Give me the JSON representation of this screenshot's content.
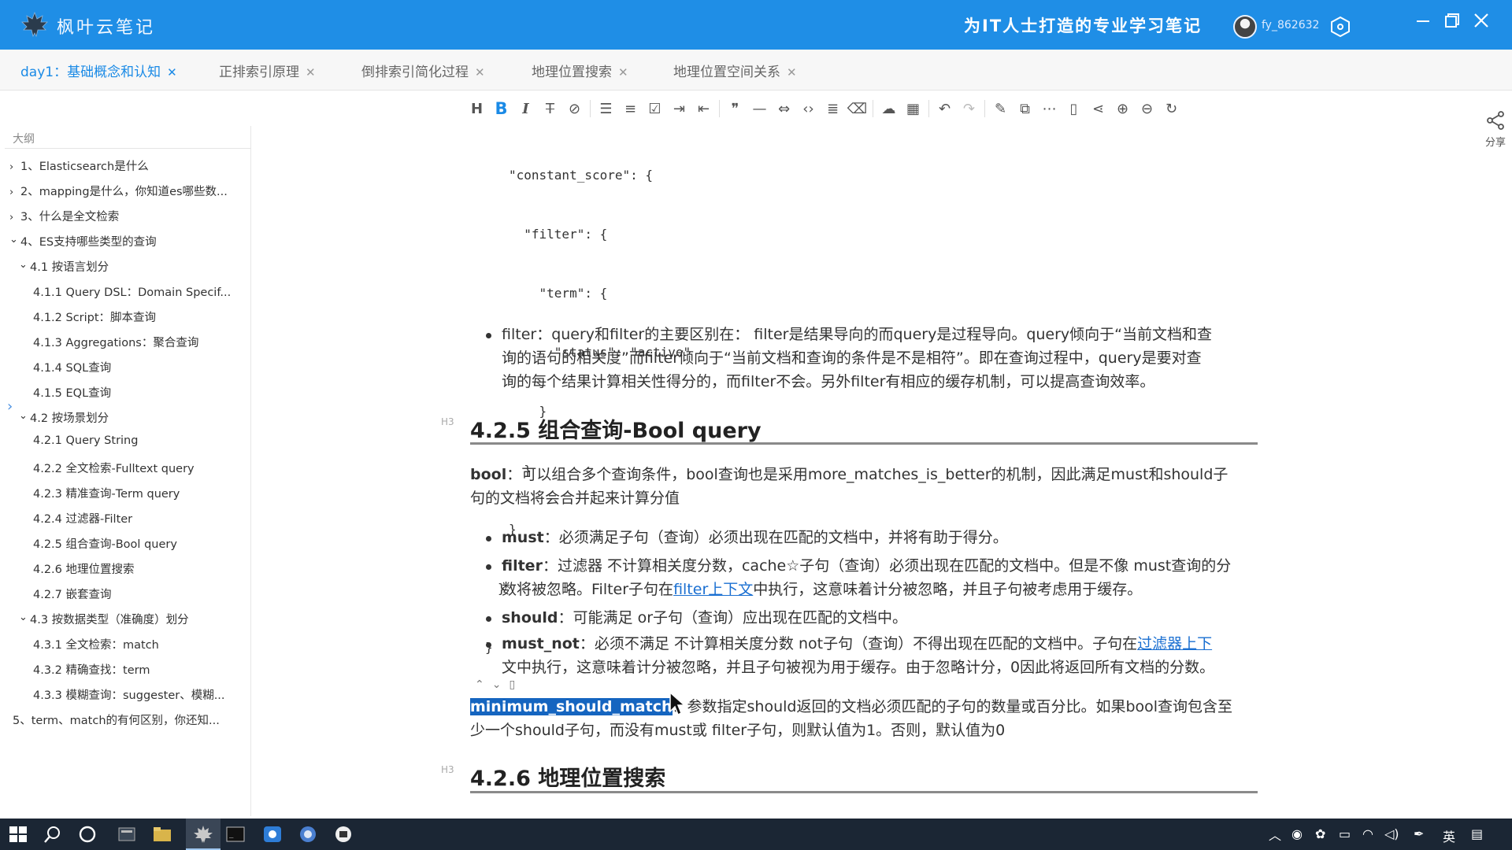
{
  "app": {
    "name": "枫叶云笔记",
    "slogan": "为IT人士打造的专业学习笔记",
    "username": "fy_862632"
  },
  "tabs": [
    {
      "label": "day1：基础概念和认知",
      "active": true
    },
    {
      "label": "正排索引原理",
      "active": false
    },
    {
      "label": "倒排索引简化过程",
      "active": false
    },
    {
      "label": "地理位置搜索",
      "active": false
    },
    {
      "label": "地理位置空间关系",
      "active": false
    }
  ],
  "toolbar": {
    "icons": [
      "heading-icon",
      "bold-icon",
      "italic-icon",
      "strikethrough-icon",
      "link-icon",
      "bullet-list-icon",
      "numbered-list-icon",
      "checkbox-icon",
      "indent-icon",
      "outdent-icon",
      "quote-icon",
      "horizontal-rule-icon",
      "code-inline-icon",
      "code-block-icon",
      "align-icon",
      "clear-format-icon",
      "cloud-icon",
      "table-icon",
      "undo-icon",
      "redo-icon",
      "edit-icon",
      "open-external-icon",
      "more-icon",
      "note-icon",
      "share-nodes-icon",
      "zoom-in-icon",
      "zoom-out-icon",
      "refresh-icon"
    ]
  },
  "share": {
    "label": "分享"
  },
  "outline": {
    "title": "大纲",
    "items": [
      {
        "label": "1、Elasticsearch是什么",
        "arrow": "right"
      },
      {
        "label": "2、mapping是什么，你知道es哪些数...",
        "arrow": "right"
      },
      {
        "label": "3、什么是全文检索",
        "arrow": "right"
      },
      {
        "label": "4、ES支持哪些类型的查询",
        "arrow": "down"
      },
      {
        "label": "4.1 按语言划分",
        "arrow": "down"
      },
      {
        "label": "4.1.1 Query DSL：Domain Specif...",
        "arrow": ""
      },
      {
        "label": "4.1.2 Script：脚本查询",
        "arrow": ""
      },
      {
        "label": "4.1.3 Aggregations：聚合查询",
        "arrow": ""
      },
      {
        "label": "4.1.4 SQL查询",
        "arrow": ""
      },
      {
        "label": "4.1.5 EQL查询",
        "arrow": ""
      },
      {
        "label": "4.2 按场景划分",
        "arrow": "down"
      },
      {
        "label": "4.2.1 Query String",
        "arrow": ""
      },
      {
        "label": "4.2.2 全文检索-Fulltext query",
        "arrow": ""
      },
      {
        "label": "4.2.3 精准查询-Term query",
        "arrow": ""
      },
      {
        "label": "4.2.4 过滤器-Filter",
        "arrow": ""
      },
      {
        "label": "4.2.5 组合查询-Bool query",
        "arrow": ""
      },
      {
        "label": "4.2.6 地理位置搜索",
        "arrow": ""
      },
      {
        "label": "4.2.7 嵌套查询",
        "arrow": ""
      },
      {
        "label": "4.3 按数据类型（准确度）划分",
        "arrow": "down"
      },
      {
        "label": "4.3.1 全文检索：match",
        "arrow": ""
      },
      {
        "label": "4.3.2 精确查找：term",
        "arrow": ""
      },
      {
        "label": "4.3.3 模糊查询：suggester、模糊...",
        "arrow": ""
      },
      {
        "label": "5、term、match的有何区别，你还知...",
        "arrow": ""
      }
    ]
  },
  "doc": {
    "code_lines": [
      "\"constant_score\": {",
      "  \"filter\": {",
      "    \"term\": {",
      "      \"status\": \"active\"",
      "    }",
      "  }",
      "}",
      "}",
      "}"
    ],
    "filter_bullet": {
      "line1": "filter：query和filter的主要区别在： filter是结果导向的而query是过程导向。query倾向于“当前文档和查",
      "line2": "询的语句的相关度”而filter倾向于“当前文档和查询的条件是不是相符”。即在查询过程中，query是要对查",
      "line3": "询的每个结果计算相关性得分的，而filter不会。另外filter有相应的缓存机制，可以提高查询效率。"
    },
    "h3_tag": "H3",
    "heading_bool": "4.2.5 组合查询-Bool query",
    "bool_intro": {
      "term": "bool",
      "line1": "：可以组合多个查询条件，bool查询也是采用more_matches_is_better的机制，因此满足must和should子",
      "line2": "句的文档将会合并起来计算分值"
    },
    "must": {
      "term": "must",
      "text": "：必须满足子句（查询）必须出现在匹配的文档中，并将有助于得分。"
    },
    "filter": {
      "term": "filter",
      "line1": "：过滤器 不计算相关度分数，cache☆子句（查询）必须出现在匹配的文档中。但是不像 must查询的分",
      "line2_a": "数将被忽略。Filter子句在",
      "line2_link": "filter上下文",
      "line2_b": "中执行，这意味着计分被忽略，并且子句被考虑用于缓存。"
    },
    "should": {
      "term": "should",
      "text": "：可能满足 or子句（查询）应出现在匹配的文档中。"
    },
    "must_not": {
      "term": "must_not",
      "line1_a": "：必须不满足 不计算相关度分数  not子句（查询）不得出现在匹配的文档中。子句在",
      "line1_link": "过滤器上下",
      "line2": "文中执行，这意味着计分被忽略，并且子句被视为用于缓存。由于忽略计分，0因此将返回所有文档的分数。"
    },
    "mini_actions": "⌃⌄🗑",
    "msm": {
      "term": "minimum_should_match",
      "line1": "：参数指定should返回的文档必须匹配的子句的数量或百分比。如果bool查询包含至",
      "line2": "少一个should子句，而没有must或 filter子句，则默认值为1。否则，默认值为0"
    },
    "heading_geo": "4.2.6 地理位置搜索"
  },
  "taskbar": {
    "ime": "英"
  }
}
